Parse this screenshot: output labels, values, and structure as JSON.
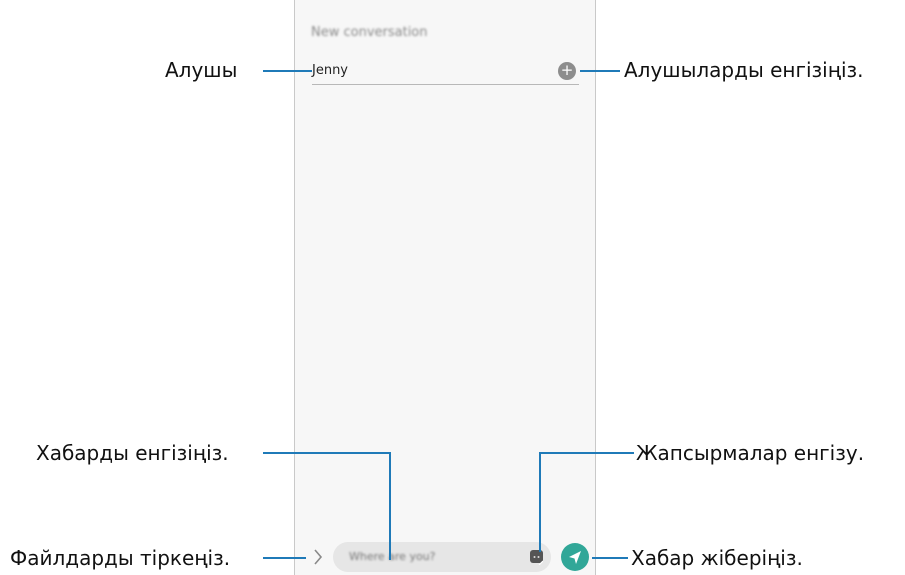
{
  "screen": {
    "title": "New conversation",
    "recipient": "Jenny",
    "message_text": "Where are you?"
  },
  "callouts": {
    "recipient": "Алушы",
    "add_recipients": "Алушыларды енгізіңіз.",
    "enter_message": "Хабарды енгізіңіз.",
    "add_stickers": "Жапсырмалар енгізу.",
    "attach_files": "Файлдарды тіркеңіз.",
    "send_message": "Хабар жіберіңіз."
  },
  "colors": {
    "accent": "#1f7ab8",
    "send": "#31a798"
  },
  "icons": [
    "add-recipient-icon",
    "attach-chevron-icon",
    "sticker-icon",
    "send-icon"
  ]
}
